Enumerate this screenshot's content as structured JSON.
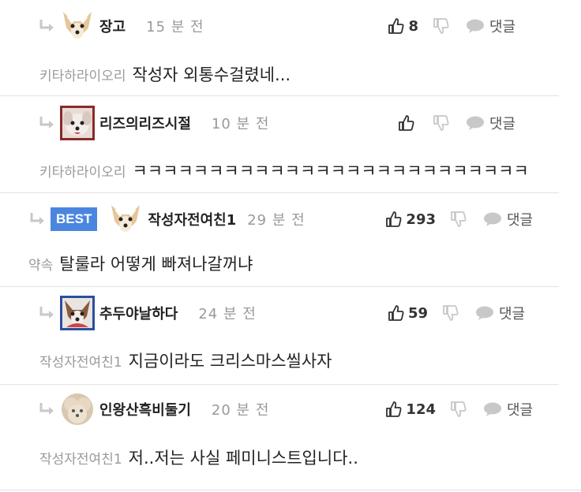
{
  "comments": [
    {
      "nickname": "장고",
      "time": "15 분 전",
      "likes": "8",
      "reply_label": "댓글",
      "reply_to": "키타하라이오리",
      "text": "작성자 외통수걸렸네...",
      "avatar": "chihuahua-avatar"
    },
    {
      "nickname": "리즈의리즈시절",
      "time": "10 분 전",
      "likes": "",
      "reply_label": "댓글",
      "reply_to": "키타하라이오리",
      "text": "ㅋㅋㅋㅋㅋㅋㅋㅋㅋㅋㅋㅋㅋㅋㅋㅋㅋㅋㅋㅋㅋㅋㅋㅋㅋㅋ",
      "avatar": "dog-red-frame-avatar"
    },
    {
      "badge": "BEST",
      "nickname": "작성자전여친1",
      "time": "29 분 전",
      "likes": "293",
      "reply_label": "댓글",
      "reply_to": "약속",
      "text": "탈룰라 어떻게 빠져나갈꺼냐",
      "avatar": "chihuahua-avatar"
    },
    {
      "nickname": "추두야날하다",
      "time": "24 분 전",
      "likes": "59",
      "reply_label": "댓글",
      "reply_to": "작성자전여친1",
      "text": "지금이라도 크리스마스씰사자",
      "avatar": "dog-blue-frame-avatar"
    },
    {
      "nickname": "인왕산흑비둘기",
      "time": "20 분 전",
      "likes": "124",
      "reply_label": "댓글",
      "reply_to": "작성자전여친1",
      "text": "저..저는 사실 페미니스트입니다..",
      "avatar": "fluffy-dog-avatar"
    }
  ]
}
